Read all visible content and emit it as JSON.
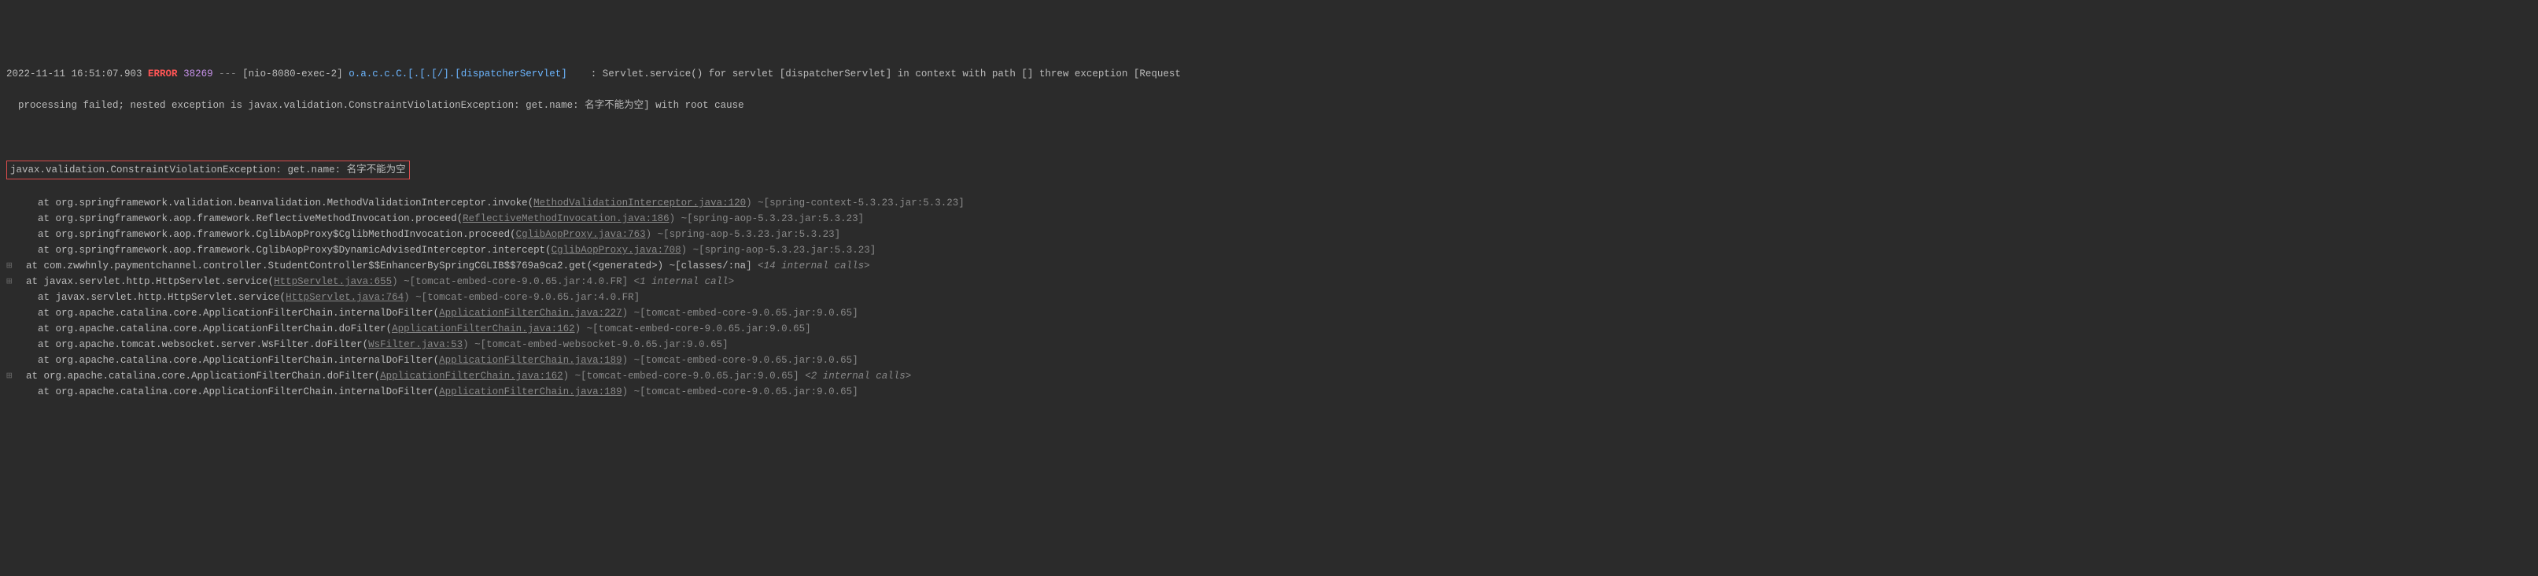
{
  "header": {
    "timestamp": "2022-11-11 16:51:07.903",
    "level": "ERROR",
    "pid": "38269",
    "dashes": "---",
    "thread": "[nio-8080-exec-2]",
    "logger": "o.a.c.c.C.[.[.[/].[dispatcherServlet]",
    "sep": "    : ",
    "msg1": "Servlet.service() for servlet [dispatcherServlet] in context with path [] threw exception [Request",
    "msg2": "  processing failed; nested exception is javax.validation.ConstraintViolationException: get.name: 名字不能为空] with root cause"
  },
  "exception": "javax.validation.ConstraintViolationException: get.name: 名字不能为空",
  "stack": [
    {
      "expand": "",
      "prefix": "    at org.springframework.validation.beanvalidation.MethodValidationInterceptor.invoke(",
      "link": "MethodValidationInterceptor.java:120",
      "close": ") ~[spring-context-5.3.23.jar:5.3.23]",
      "fold": ""
    },
    {
      "expand": "",
      "prefix": "    at org.springframework.aop.framework.ReflectiveMethodInvocation.proceed(",
      "link": "ReflectiveMethodInvocation.java:186",
      "close": ") ~[spring-aop-5.3.23.jar:5.3.23]",
      "fold": ""
    },
    {
      "expand": "",
      "prefix": "    at org.springframework.aop.framework.CglibAopProxy$CglibMethodInvocation.proceed(",
      "link": "CglibAopProxy.java:763",
      "close": ") ~[spring-aop-5.3.23.jar:5.3.23]",
      "fold": ""
    },
    {
      "expand": "",
      "prefix": "    at org.springframework.aop.framework.CglibAopProxy$DynamicAdvisedInterceptor.intercept(",
      "link": "CglibAopProxy.java:708",
      "close": ") ~[spring-aop-5.3.23.jar:5.3.23]",
      "fold": ""
    },
    {
      "expand": "⊞",
      "prefix": "  at com.zwwhnly.paymentchannel.controller.StudentController$$EnhancerBySpringCGLIB$$769a9ca2.get(<generated>) ~[classes/:na] ",
      "link": "",
      "close": "",
      "fold": "<14 internal calls>"
    },
    {
      "expand": "⊞",
      "prefix": "  at javax.servlet.http.HttpServlet.service(",
      "link": "HttpServlet.java:655",
      "close": ") ~[tomcat-embed-core-9.0.65.jar:4.0.FR] ",
      "fold": "<1 internal call>"
    },
    {
      "expand": "",
      "prefix": "    at javax.servlet.http.HttpServlet.service(",
      "link": "HttpServlet.java:764",
      "close": ") ~[tomcat-embed-core-9.0.65.jar:4.0.FR]",
      "fold": ""
    },
    {
      "expand": "",
      "prefix": "    at org.apache.catalina.core.ApplicationFilterChain.internalDoFilter(",
      "link": "ApplicationFilterChain.java:227",
      "close": ") ~[tomcat-embed-core-9.0.65.jar:9.0.65]",
      "fold": ""
    },
    {
      "expand": "",
      "prefix": "    at org.apache.catalina.core.ApplicationFilterChain.doFilter(",
      "link": "ApplicationFilterChain.java:162",
      "close": ") ~[tomcat-embed-core-9.0.65.jar:9.0.65]",
      "fold": ""
    },
    {
      "expand": "",
      "prefix": "    at org.apache.tomcat.websocket.server.WsFilter.doFilter(",
      "link": "WsFilter.java:53",
      "close": ") ~[tomcat-embed-websocket-9.0.65.jar:9.0.65]",
      "fold": ""
    },
    {
      "expand": "",
      "prefix": "    at org.apache.catalina.core.ApplicationFilterChain.internalDoFilter(",
      "link": "ApplicationFilterChain.java:189",
      "close": ") ~[tomcat-embed-core-9.0.65.jar:9.0.65]",
      "fold": ""
    },
    {
      "expand": "⊞",
      "prefix": "  at org.apache.catalina.core.ApplicationFilterChain.doFilter(",
      "link": "ApplicationFilterChain.java:162",
      "close": ") ~[tomcat-embed-core-9.0.65.jar:9.0.65] ",
      "fold": "<2 internal calls>"
    },
    {
      "expand": "",
      "prefix": "    at org.apache.catalina.core.ApplicationFilterChain.internalDoFilter(",
      "link": "ApplicationFilterChain.java:189",
      "close": ") ~[tomcat-embed-core-9.0.65.jar:9.0.65]",
      "fold": ""
    }
  ]
}
